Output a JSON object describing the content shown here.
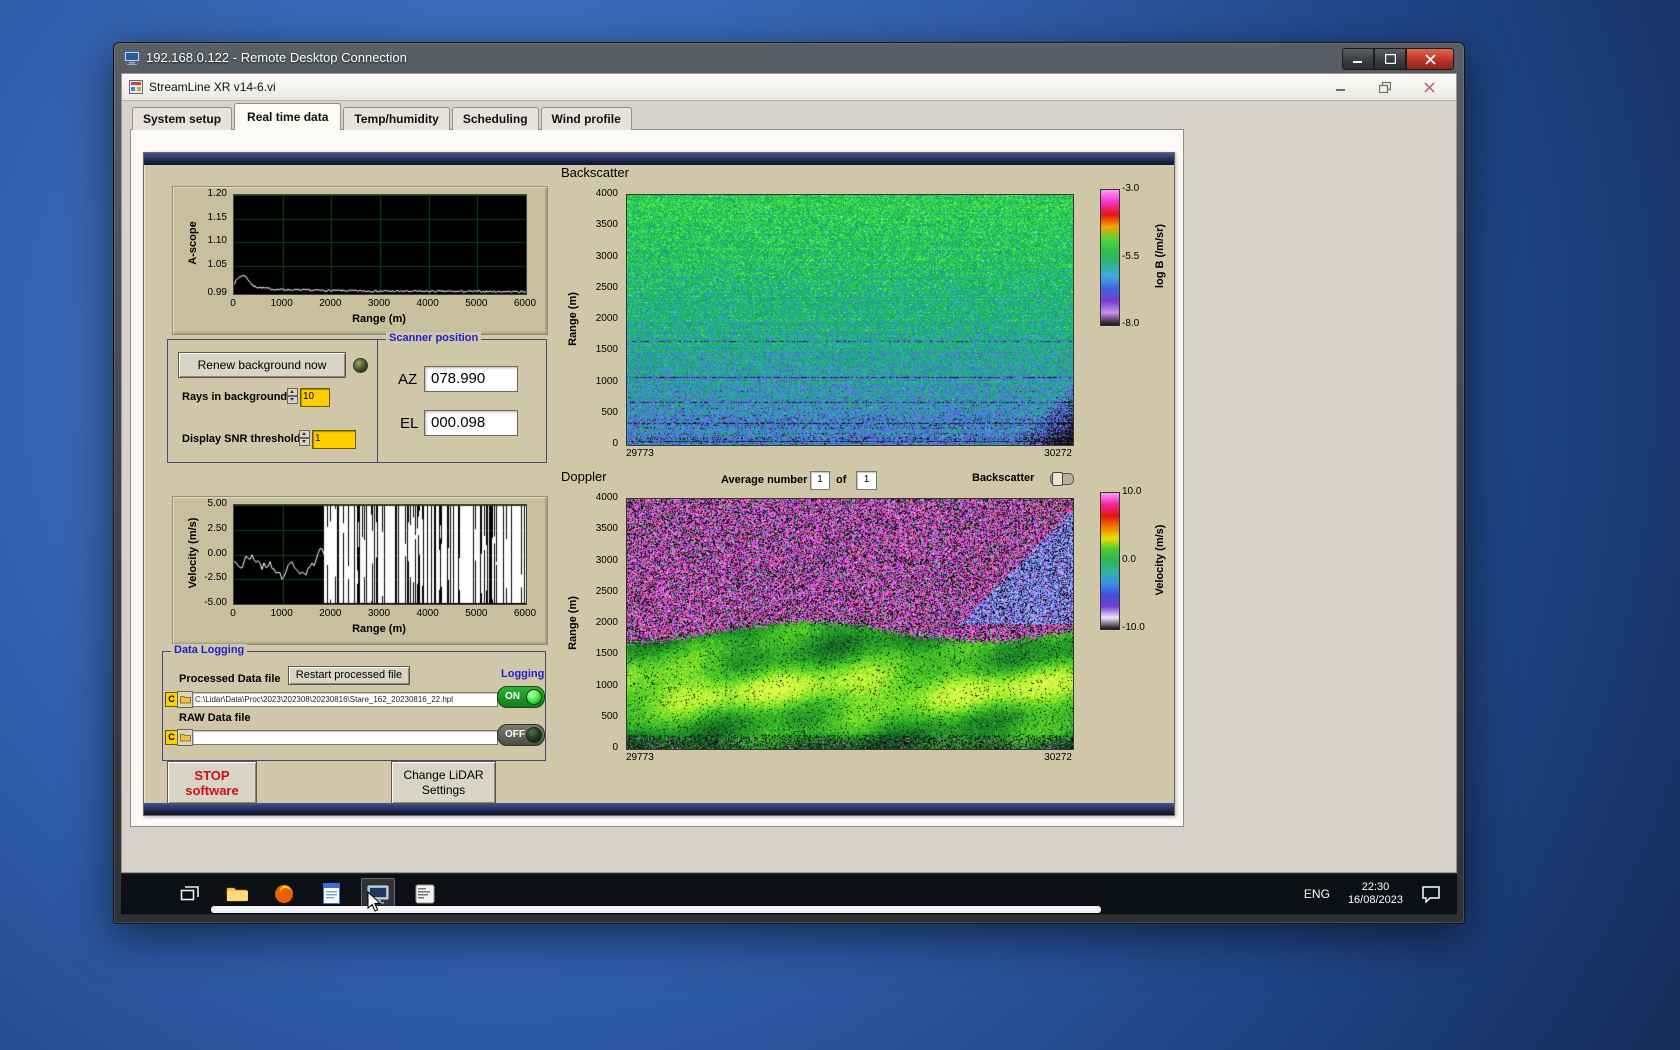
{
  "rdp": {
    "title": "192.168.0.122 - Remote Desktop Connection"
  },
  "app": {
    "title": "StreamLine XR v14-6.vi",
    "active_tab": "Real time data",
    "tabs": [
      {
        "label": "System setup"
      },
      {
        "label": "Real time data"
      },
      {
        "label": "Temp/humidity"
      },
      {
        "label": "Scheduling"
      },
      {
        "label": "Wind profile"
      }
    ]
  },
  "panel": {
    "controls": {
      "renew_button_label": "Renew background now",
      "rays_label": "Rays in background",
      "rays_value": "10",
      "snr_label": "Display SNR threshold",
      "snr_value": "1"
    },
    "scanner": {
      "title": "Scanner position",
      "az_label": "AZ",
      "az_value": "078.990",
      "el_label": "EL",
      "el_value": "000.098"
    },
    "averaging": {
      "average_label": "Average number",
      "average_value": "1",
      "of_label": "of",
      "of_value": "1",
      "toggle_label": "Backscatter"
    },
    "logging": {
      "title": "Data Logging",
      "processed_label": "Processed Data file",
      "restart_button_label": "Restart processed file",
      "logging_label": "Logging",
      "drive_letter": "C",
      "processed_path": "C:\\Lidar\\Data\\Proc\\2023\\202308\\20230816\\Stare_162_20230816_22.hpl",
      "on_label": "ON",
      "raw_label": "RAW Data file",
      "raw_path": "",
      "off_label": "OFF"
    },
    "stop_button": {
      "line1": "STOP",
      "line2": "software"
    },
    "change_button": {
      "line1": "Change LiDAR",
      "line2": "Settings"
    }
  },
  "taskbar": {
    "language": "ENG",
    "time": "22:30",
    "date": "16/08/2023",
    "icons": [
      "task-view",
      "file-explorer",
      "firefox",
      "notes-app",
      "remote-desktop",
      "sign-scheduler"
    ]
  },
  "chart_data": [
    {
      "type": "line",
      "title": "A-scope",
      "ylabel": "A-scope",
      "xlabel": "Range (m)",
      "xlim": [
        0,
        6000
      ],
      "ylim": [
        0.99,
        1.2
      ],
      "xticks": [
        "0",
        "1000",
        "2000",
        "3000",
        "4000",
        "5000",
        "6000"
      ],
      "yticks": [
        "1.20",
        "1.15",
        "1.10",
        "1.05",
        "0.99"
      ],
      "grid": true,
      "bg": "#000000",
      "series": [
        {
          "name": "a-scope-trace",
          "color": "#ffffff",
          "profile": [
            [
              0,
              1.012
            ],
            [
              100,
              1.026
            ],
            [
              220,
              1.03
            ],
            [
              400,
              1.006
            ],
            [
              800,
              1.0
            ],
            [
              1500,
              0.998
            ],
            [
              3000,
              0.996
            ],
            [
              6000,
              0.995
            ]
          ],
          "noise": 0.0022
        }
      ]
    },
    {
      "type": "heatmap",
      "title": "Backscatter",
      "ylabel": "Range (m)",
      "xlim": [
        29773,
        30272
      ],
      "ylim": [
        0,
        4000
      ],
      "xticks": [
        "29773",
        "30272"
      ],
      "yticks": [
        "4000",
        "3500",
        "3000",
        "2500",
        "2000",
        "1500",
        "1000",
        "500",
        "0"
      ],
      "colorbar": {
        "label": "log B (/m/sr)",
        "ticks": [
          "-3.0",
          "-5.5",
          "-8.0"
        ],
        "range": [
          -3.0,
          -8.0
        ],
        "colors": [
          "#ff9bff",
          "#f530c8",
          "#e81414",
          "#f0a800",
          "#57d23c",
          "#2fbe46",
          "#2db389",
          "#44a9e0",
          "#3f66dd",
          "#6f3fd0",
          "#c98fe8",
          "#141414"
        ]
      },
      "description": "Aerosol backscatter time-height speckle: green turbulent noise, bluer toward low ranges, faint horizontal streaks, attenuated diagonal band at right edge, bright returns near 500-1000 m"
    },
    {
      "type": "line",
      "title": "Velocity",
      "ylabel": "Velocity (m/s)",
      "xlabel": "Range (m)",
      "xlim": [
        0,
        6000
      ],
      "ylim": [
        -5,
        5
      ],
      "xticks": [
        "0",
        "1000",
        "2000",
        "3000",
        "4000",
        "5000",
        "6000"
      ],
      "yticks": [
        "5.00",
        "2.50",
        "0.00",
        "-2.50",
        "-5.00"
      ],
      "grid": true,
      "bg": "#000000",
      "series": [
        {
          "name": "velocity-trace",
          "color": "#ffffff",
          "coherent_until": 1850,
          "coherent_range": [
            -4.2,
            0.6
          ],
          "description": "coherent Doppler velocity between ~0 and -4 m/s out to ~1850 m, uncorrelated full-scale noise bars beyond"
        }
      ]
    },
    {
      "type": "heatmap",
      "title": "Doppler",
      "ylabel": "Range (m)",
      "xlim": [
        29773,
        30272
      ],
      "ylim": [
        0,
        4000
      ],
      "xticks": [
        "29773",
        "30272"
      ],
      "yticks": [
        "4000",
        "3500",
        "3000",
        "2500",
        "2000",
        "1500",
        "1000",
        "500",
        "0"
      ],
      "colorbar": {
        "label": "Velocity (m/s)",
        "ticks": [
          "10.0",
          "0.0",
          "-10.0"
        ],
        "range": [
          10.0,
          -10.0
        ],
        "colors": [
          "#ff9bff",
          "#f2259f",
          "#e81414",
          "#f07800",
          "#e8e000",
          "#49c832",
          "#2db456",
          "#2fb4a8",
          "#3f8ce0",
          "#3f50dd",
          "#6f3fd0",
          "#efe6f8",
          "#141414"
        ]
      },
      "description": "Random magenta/black velocity noise above ~2000 m with blue patch at right edge, coherent green field below ~1800 m with bright yellow-green layers near 500-1000 m"
    }
  ]
}
